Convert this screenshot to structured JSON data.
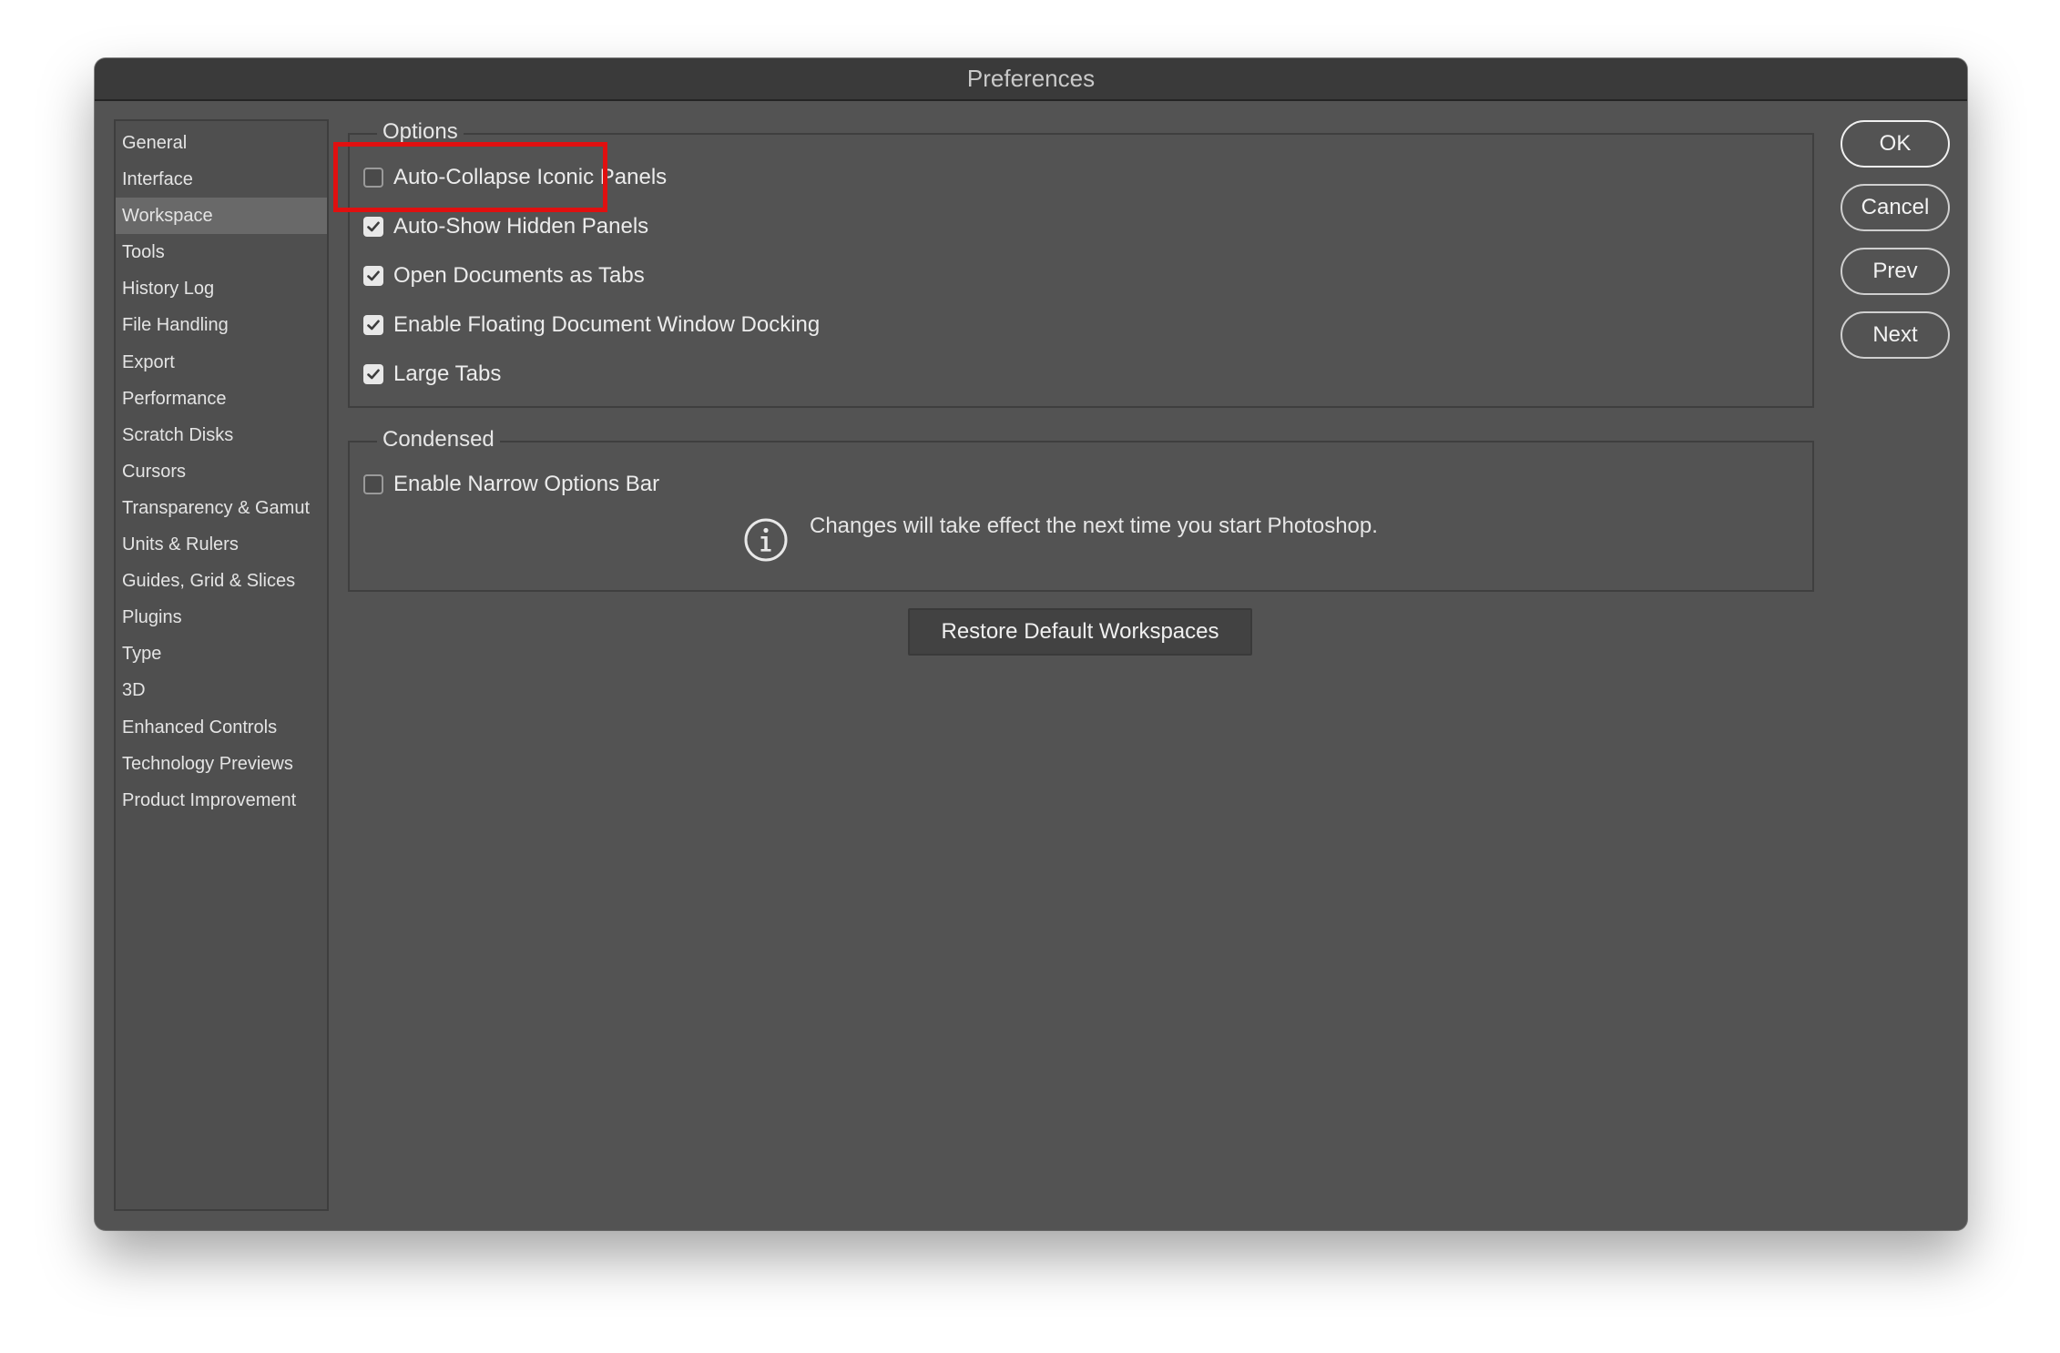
{
  "window": {
    "title": "Preferences"
  },
  "sidebar": {
    "selected_index": 2,
    "items": [
      {
        "label": "General"
      },
      {
        "label": "Interface"
      },
      {
        "label": "Workspace"
      },
      {
        "label": "Tools"
      },
      {
        "label": "History Log"
      },
      {
        "label": "File Handling"
      },
      {
        "label": "Export"
      },
      {
        "label": "Performance"
      },
      {
        "label": "Scratch Disks"
      },
      {
        "label": "Cursors"
      },
      {
        "label": "Transparency & Gamut"
      },
      {
        "label": "Units & Rulers"
      },
      {
        "label": "Guides, Grid & Slices"
      },
      {
        "label": "Plugins"
      },
      {
        "label": "Type"
      },
      {
        "label": "3D"
      },
      {
        "label": "Enhanced Controls"
      },
      {
        "label": "Technology Previews"
      },
      {
        "label": "Product Improvement"
      }
    ]
  },
  "options": {
    "legend": "Options",
    "items": [
      {
        "label": "Auto-Collapse Iconic Panels",
        "checked": false
      },
      {
        "label": "Auto-Show Hidden Panels",
        "checked": true
      },
      {
        "label": "Open Documents as Tabs",
        "checked": true
      },
      {
        "label": "Enable Floating Document Window Docking",
        "checked": true
      },
      {
        "label": "Large Tabs",
        "checked": true
      }
    ]
  },
  "condensed": {
    "legend": "Condensed",
    "items": [
      {
        "label": "Enable Narrow Options Bar",
        "checked": false
      }
    ],
    "info_text": "Changes will take effect the next time you start Photoshop."
  },
  "restore_button": {
    "label": "Restore Default Workspaces"
  },
  "buttons": {
    "ok": "OK",
    "cancel": "Cancel",
    "prev": "Prev",
    "next": "Next"
  },
  "colors": {
    "window_bg": "#535353",
    "highlight": "#e01010"
  },
  "icons": {
    "checkmark": "checkmark-icon",
    "info": "info-icon"
  }
}
